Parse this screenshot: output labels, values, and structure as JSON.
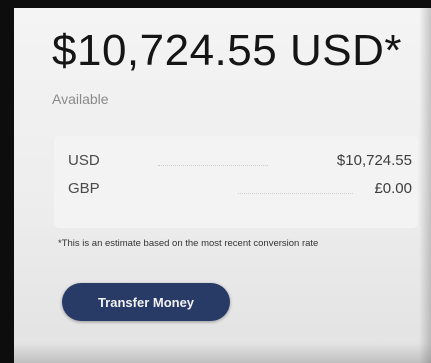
{
  "account": {
    "balance": "$10,724.55 USD*",
    "available_label": "Available"
  },
  "balances": [
    {
      "currency": "USD",
      "amount": "$10,724.55"
    },
    {
      "currency": "GBP",
      "amount": "£0.00"
    }
  ],
  "note": "*This is an estimate based on the most recent conversion rate",
  "actions": {
    "transfer_label": "Transfer Money"
  },
  "colors": {
    "button_bg": "#283a66",
    "button_text": "#f2f2f2",
    "background": "#f0f0f0"
  }
}
